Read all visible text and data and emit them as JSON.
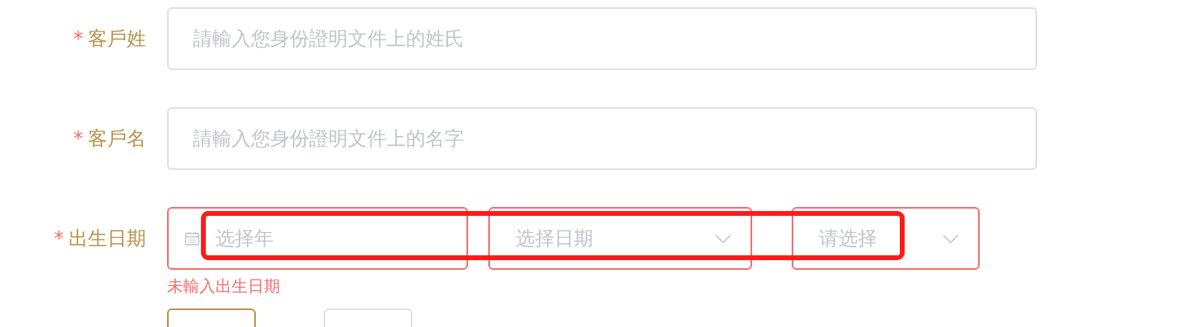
{
  "fields": [
    {
      "kind": "text",
      "required_mark": "*",
      "label": "客戶姓",
      "placeholder": "請輸入您身份證明文件上的姓氏",
      "invalid": false
    },
    {
      "kind": "text",
      "required_mark": "*",
      "label": "客戶名",
      "placeholder": "請輸入您身份證明文件上的名字",
      "invalid": false
    },
    {
      "kind": "date",
      "required_mark": "*",
      "label": "出生日期",
      "invalid": true,
      "error": "未輸入出生日期",
      "highlight": true,
      "parts": [
        {
          "kind": "year",
          "placeholder": "选择年"
        },
        {
          "kind": "select",
          "placeholder": "选择日期"
        },
        {
          "kind": "select",
          "placeholder": "请选择"
        }
      ]
    }
  ],
  "options": [
    {
      "selected": true
    },
    {
      "selected": false
    }
  ]
}
